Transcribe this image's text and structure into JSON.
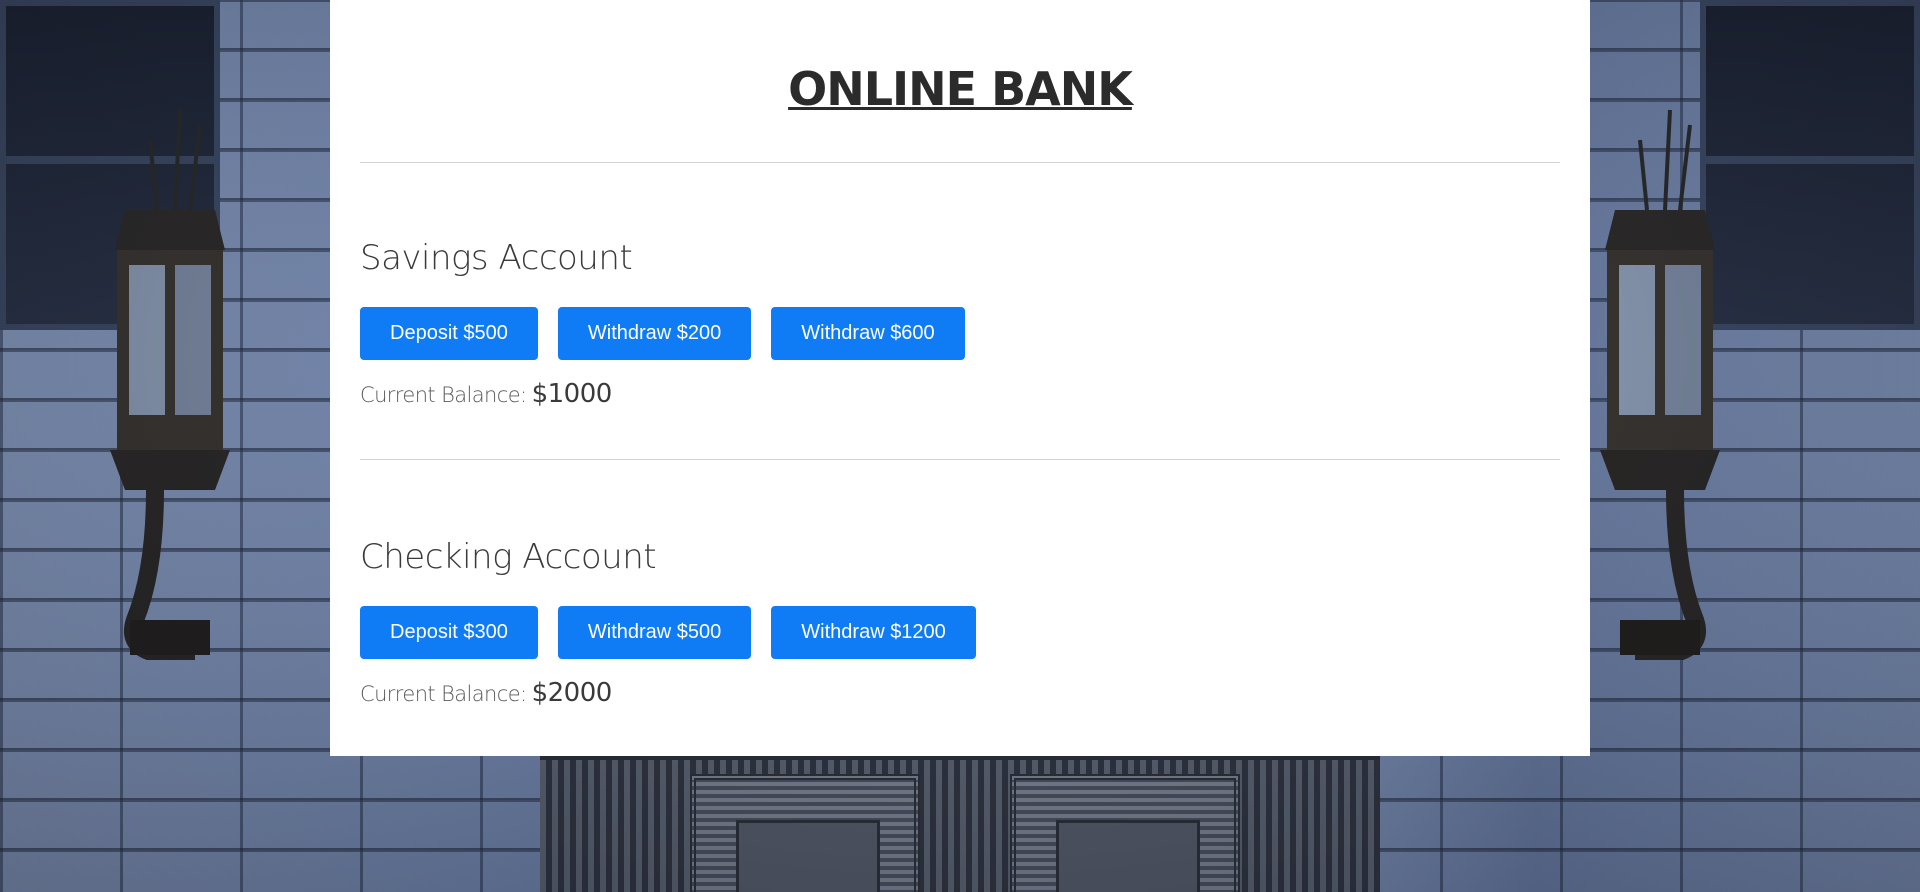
{
  "app": {
    "title": "ONLINE BANK"
  },
  "accounts": [
    {
      "name": "Savings Account",
      "buttons": [
        {
          "label": "Deposit $500"
        },
        {
          "label": "Withdraw $200"
        },
        {
          "label": "Withdraw $600"
        }
      ],
      "balance_label": "Current Balance:",
      "balance_value": "$1000"
    },
    {
      "name": "Checking Account",
      "buttons": [
        {
          "label": "Deposit $300"
        },
        {
          "label": "Withdraw $500"
        },
        {
          "label": "Withdraw $1200"
        }
      ],
      "balance_label": "Current Balance:",
      "balance_value": "$2000"
    }
  ],
  "theme": {
    "button_color": "#0f7cf6",
    "card_background": "#ffffff",
    "text_color": "#3a3a3a"
  }
}
